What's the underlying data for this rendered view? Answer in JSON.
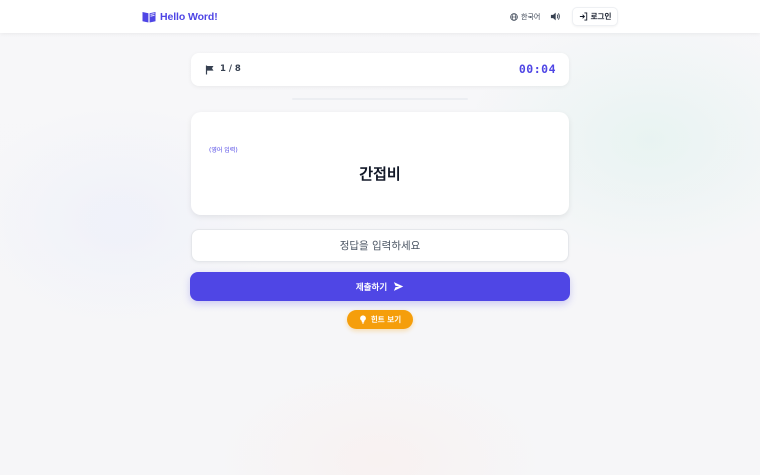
{
  "header": {
    "logo_text": "Hello Word!",
    "language_label": "한국어",
    "login_label": "로그인"
  },
  "quiz": {
    "progress_text": "1 / 8",
    "timer": "00:04",
    "input_mode_tag": "(영어 입력)",
    "word": "간접비",
    "answer_placeholder": "정답을 입력하세요",
    "answer_value": "",
    "submit_label": "제출하기",
    "hint_label": "힌트 보기"
  },
  "colors": {
    "accent": "#4f46e5",
    "hint": "#f59e0b"
  },
  "icons": {
    "logo": "book-open-icon",
    "language": "globe-icon",
    "sound": "speaker-icon",
    "login": "login-icon",
    "progress": "flag-icon",
    "submit": "send-icon",
    "hint": "lightbulb-icon"
  }
}
